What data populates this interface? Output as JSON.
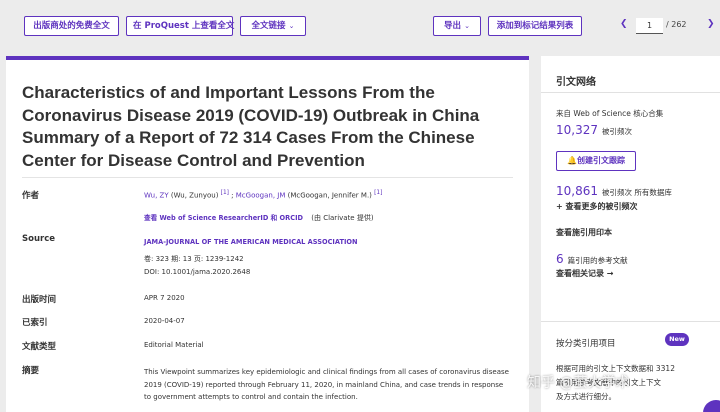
{
  "toolbar": {
    "free_fulltext": "出版商处的免费全文",
    "proquest": "在 ProQuest 上查看全文",
    "fulltext_links": "全文链接",
    "export": "导出",
    "add_to_marked": "添加到标记结果列表",
    "page_current": "1",
    "page_total": "/ 262"
  },
  "article": {
    "title": "Characteristics of and Important Lessons From the Coronavirus Disease 2019 (COVID-19) Outbreak in China Summary of a Report of 72 314 Cases From the Chinese Center for Disease Control and Prevention",
    "authors_label": "作者",
    "author1": "Wu, ZY",
    "author1_full": "(Wu, Zunyou)",
    "author1_ref": "[1]",
    "author_sep": ";",
    "author2": "McGoogan, JM",
    "author2_full": "(McGoogan, Jennifer M.)",
    "author2_ref": "[1]",
    "researcher_link": "查看 Web of Science ResearcherID 和 ORCID",
    "researcher_note": "(由 Clarivate 提供)",
    "source_label": "Source",
    "journal": "JAMA-JOURNAL OF THE AMERICAN MEDICAL ASSOCIATION",
    "volume_line": "卷: 323     期: 13     页: 1239-1242",
    "doi": "DOI: 10.1001/jama.2020.2648",
    "pubdate_label": "出版时间",
    "pubdate": "APR 7 2020",
    "indexed_label": "已索引",
    "indexed": "2020-04-07",
    "doctype_label": "文献类型",
    "doctype": "Editorial Material",
    "abstract_label": "摘要",
    "abstract": "This Viewpoint summarizes key epidemiologic and clinical findings from all cases of coronavirus disease 2019 (COVID-19) reported through February 11, 2020, in mainland China, and case trends in response to government attempts to control and contain the infection."
  },
  "sidebar": {
    "heading": "引文网络",
    "from_wos": "来自 Web of Science 核心合集",
    "cited_count": "10,327",
    "cited_label": "被引频次",
    "create_alert": "创建引文跟踪",
    "all_db_count": "10,861",
    "all_db_label": "被引频次 所有数据库",
    "see_more": "+ 查看更多的被引频次",
    "cited_refs": "查看施引用印本",
    "refs_count": "6",
    "refs_label": "篇引用的参考文献",
    "view_related": "查看相关记录 →",
    "classify": "按分类引用项目",
    "new_badge": "New",
    "classify_desc_1": "根据可用的引文上下文数据和 3312",
    "classify_desc_2": "篇引用参考文献中的引文上下文",
    "classify_desc_3": "及方式进行细分。"
  },
  "watermark": "知乎 @萤火学术",
  "colors": {
    "accent": "#5e33bf",
    "background": "#ececec"
  }
}
